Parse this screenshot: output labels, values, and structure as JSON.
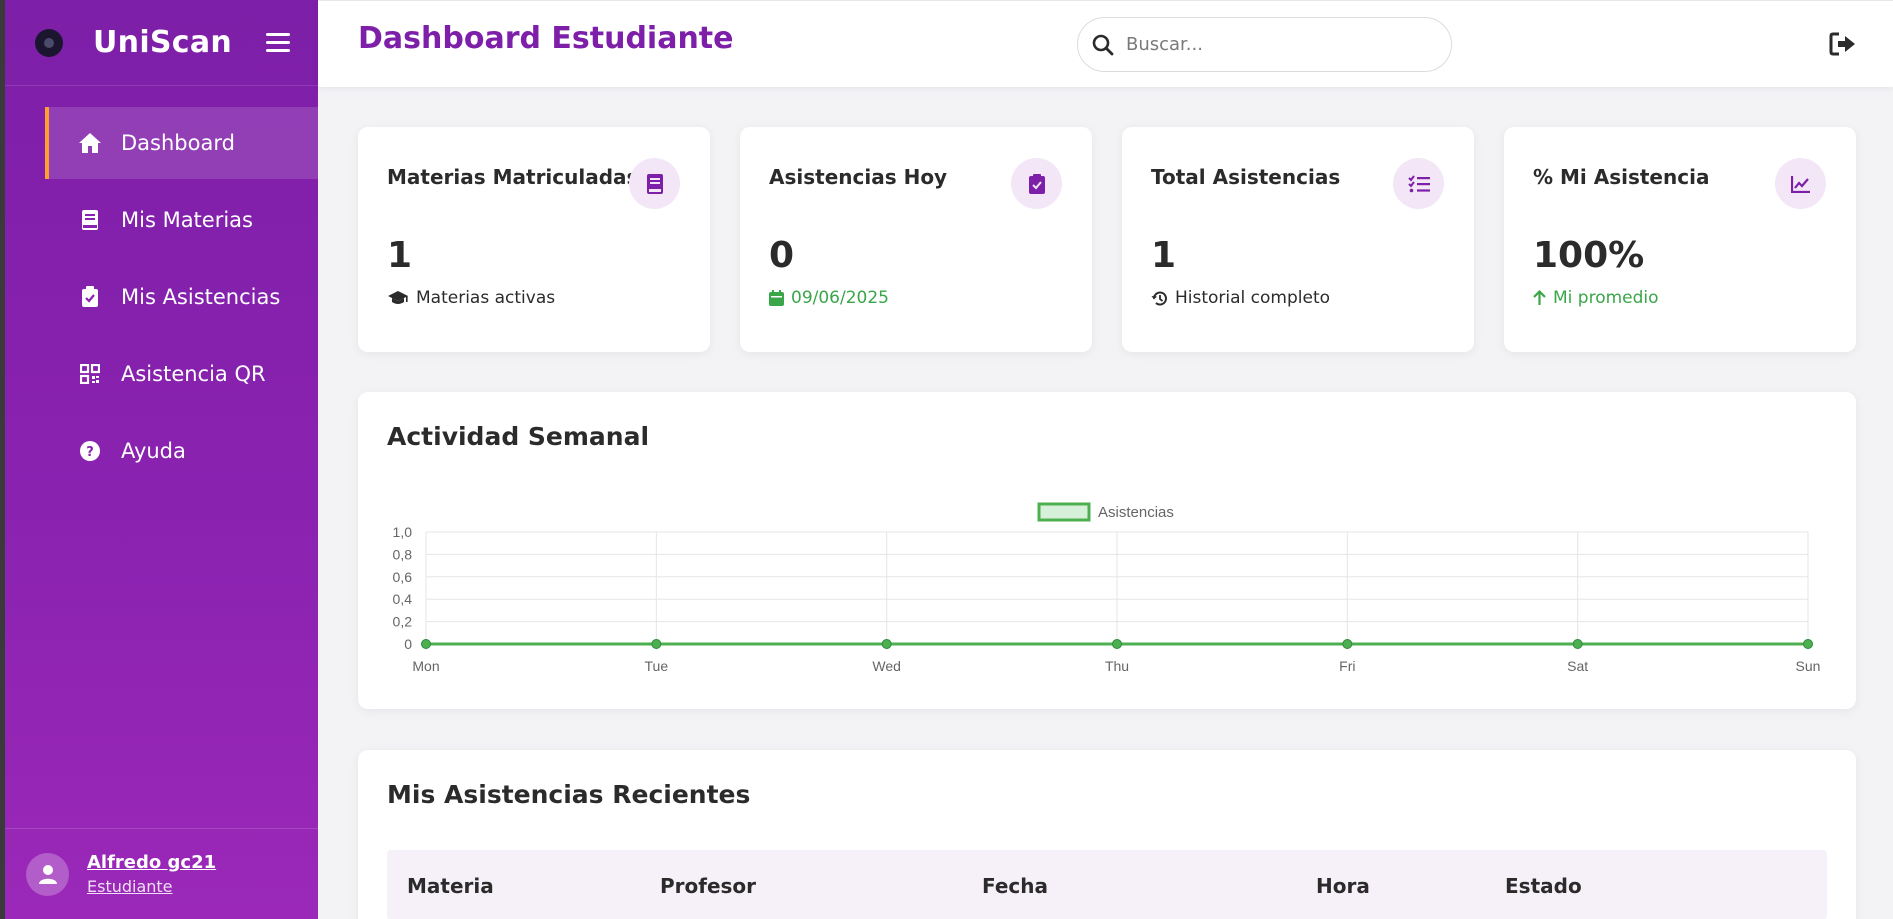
{
  "brand": {
    "title": "UniScan"
  },
  "sidebar": {
    "items": [
      {
        "label": "Dashboard",
        "icon": "home-icon",
        "active": true
      },
      {
        "label": "Mis Materias",
        "icon": "book-icon"
      },
      {
        "label": "Mis Asistencias",
        "icon": "clipboard-check-icon"
      },
      {
        "label": "Asistencia QR",
        "icon": "qrcode-icon"
      },
      {
        "label": "Ayuda",
        "icon": "help-icon"
      }
    ]
  },
  "user": {
    "name": "Alfredo gc21",
    "role": "Estudiante"
  },
  "header": {
    "title": "Dashboard Estudiante",
    "search_placeholder": "Buscar..."
  },
  "stats": [
    {
      "title": "Materias Matriculadas",
      "value": "1",
      "sub": "Materias activas",
      "icon": "book-icon",
      "sub_icon": "graduation-cap-icon"
    },
    {
      "title": "Asistencias Hoy",
      "value": "0",
      "sub": "09/06/2025",
      "icon": "clipboard-check-icon",
      "sub_icon": "calendar-icon"
    },
    {
      "title": "Total Asistencias",
      "value": "1",
      "sub": "Historial completo",
      "icon": "list-check-icon",
      "sub_icon": "history-icon"
    },
    {
      "title": "% Mi Asistencia",
      "value": "100%",
      "sub": "Mi promedio",
      "icon": "chart-line-icon",
      "sub_icon": "arrow-up-icon"
    }
  ],
  "activity": {
    "title": "Actividad Semanal"
  },
  "chart_data": {
    "type": "line",
    "categories": [
      "Mon",
      "Tue",
      "Wed",
      "Thu",
      "Fri",
      "Sat",
      "Sun"
    ],
    "series": [
      {
        "name": "Asistencias",
        "values": [
          0,
          0,
          0,
          0,
          0,
          0,
          0
        ]
      }
    ],
    "ylim": [
      0,
      1
    ],
    "yticks": [
      "1,0",
      "0,8",
      "0,6",
      "0,4",
      "0,2",
      "0"
    ],
    "legend": "top-center",
    "grid": true,
    "color": "#4caf50"
  },
  "recent": {
    "title": "Mis Asistencias Recientes",
    "columns": [
      "Materia",
      "Profesor",
      "Fecha",
      "Hora",
      "Estado"
    ]
  },
  "colors": {
    "primary": "#7d1fa8",
    "accent": "#ff9f2e",
    "success": "#3aa64a"
  }
}
